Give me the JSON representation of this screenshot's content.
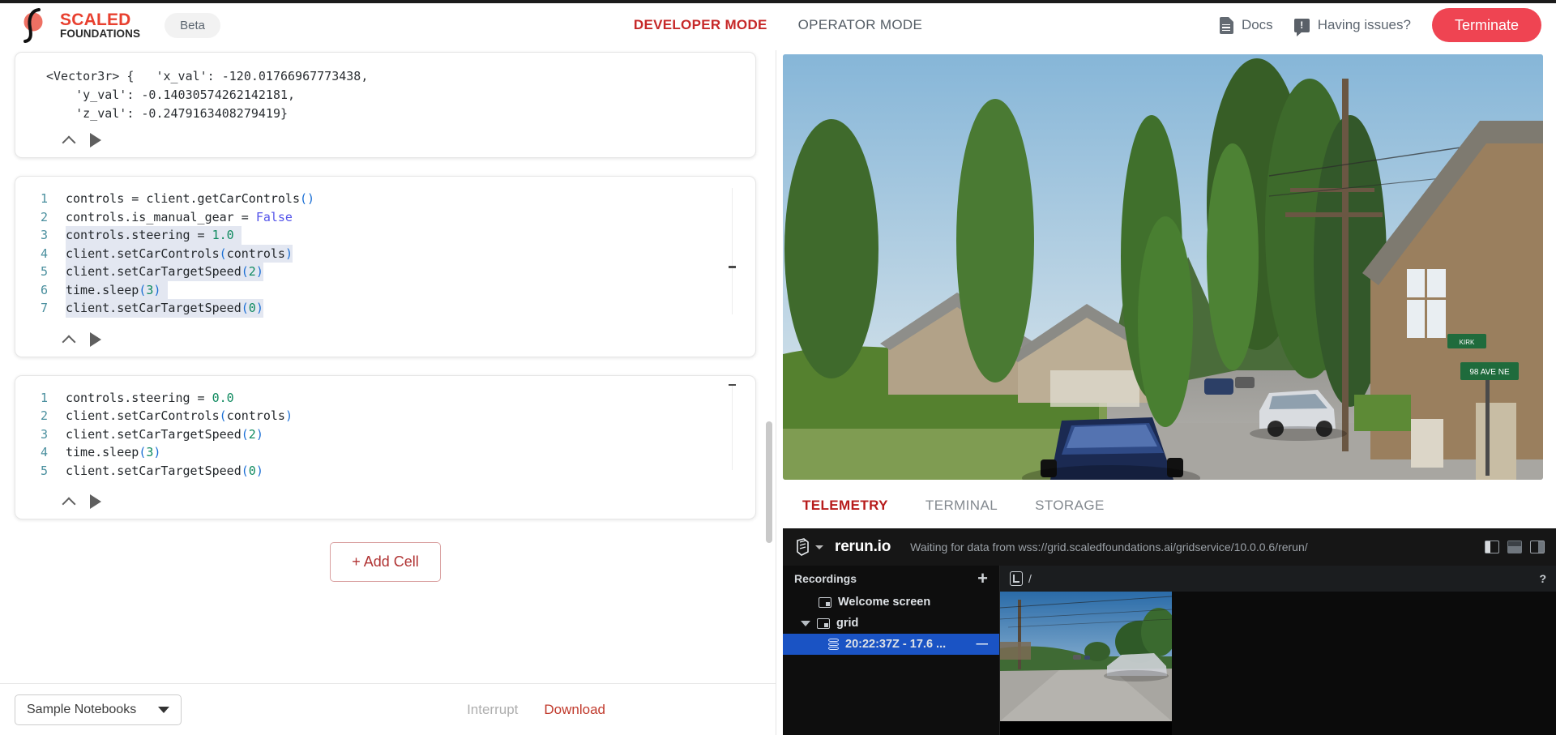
{
  "topbar": {
    "logo_line1": "SCALED",
    "logo_line2": "FOUNDATIONS",
    "beta_label": "Beta",
    "modes": [
      {
        "label": "DEVELOPER MODE",
        "active": true
      },
      {
        "label": "OPERATOR MODE",
        "active": false
      }
    ],
    "docs_label": "Docs",
    "issues_label": "Having issues?",
    "terminate_label": "Terminate",
    "accent_red": "#c62828",
    "terminate_bg": "#ef4452"
  },
  "notebook": {
    "cells": [
      {
        "type": "output",
        "output_text": "<Vector3r> {   'x_val': -120.01766967773438,\n    'y_val': -0.14030574262142181,\n    'z_val': -0.2479163408279419}"
      },
      {
        "type": "code",
        "lines": [
          {
            "n": "1",
            "text": "controls = client.getCarControls()"
          },
          {
            "n": "2",
            "text": "controls.is_manual_gear = False"
          },
          {
            "n": "3",
            "text": "controls.steering = 1.0"
          },
          {
            "n": "4",
            "text": "client.setCarControls(controls)"
          },
          {
            "n": "5",
            "text": "client.setCarTargetSpeed(2)"
          },
          {
            "n": "6",
            "text": "time.sleep(3)"
          },
          {
            "n": "7",
            "text": "client.setCarTargetSpeed(0)"
          }
        ]
      },
      {
        "type": "code",
        "lines": [
          {
            "n": "1",
            "text": "controls.steering = 0.0"
          },
          {
            "n": "2",
            "text": "client.setCarControls(controls)"
          },
          {
            "n": "3",
            "text": "client.setCarTargetSpeed(2)"
          },
          {
            "n": "4",
            "text": "time.sleep(3)"
          },
          {
            "n": "5",
            "text": "client.setCarTargetSpeed(0)"
          }
        ]
      }
    ],
    "add_cell_label": "+ Add Cell",
    "sample_notebooks_label": "Sample Notebooks",
    "interrupt_label": "Interrupt",
    "download_label": "Download"
  },
  "right": {
    "tabs": [
      {
        "label": "TELEMETRY",
        "active": true
      },
      {
        "label": "TERMINAL",
        "active": false
      },
      {
        "label": "STORAGE",
        "active": false
      }
    ],
    "street_sign_line1": "KIRK",
    "street_sign_line2": "98 AVE NE"
  },
  "rerun": {
    "wordmark": "rerun.io",
    "status": "Waiting for data from wss://grid.scaledfoundations.ai/gridservice/10.0.0.6/rerun/",
    "recordings_title": "Recordings",
    "add_label": "+",
    "tree": [
      {
        "label": "Welcome screen",
        "icon": "blueprint-icon",
        "depth": 1,
        "selected": false,
        "expandable": false
      },
      {
        "label": "grid",
        "icon": "blueprint-icon",
        "depth": 0,
        "selected": false,
        "expandable": true
      },
      {
        "label": "20:22:37Z - 17.6 ...",
        "icon": "database-icon",
        "depth": 2,
        "selected": true,
        "expandable": false,
        "trailing": "—"
      }
    ],
    "breadcrumb_path": "/",
    "help_label": "?"
  }
}
